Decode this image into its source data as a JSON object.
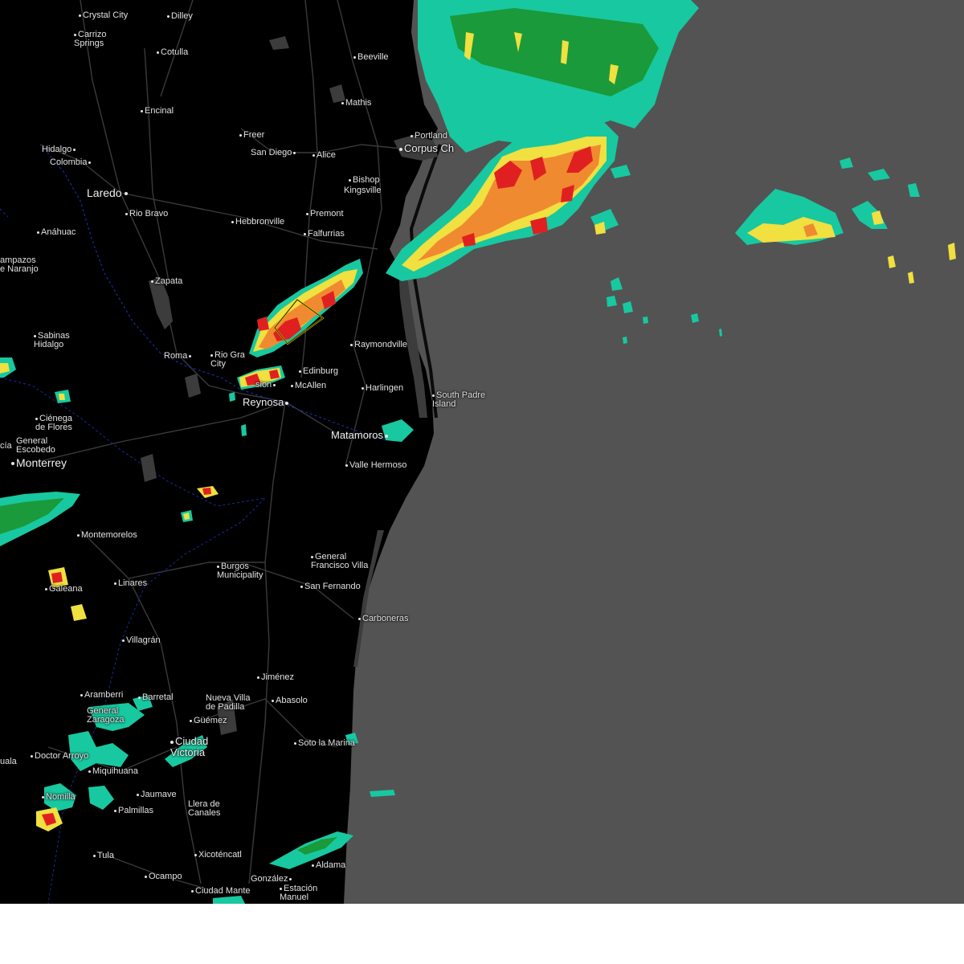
{
  "map": {
    "cities": [
      {
        "id": "crystal-city",
        "name": "Crystal City",
        "major": false
      },
      {
        "id": "dilley",
        "name": "Dilley",
        "major": false
      },
      {
        "id": "carrizo-springs",
        "name": "Carrizo\nSprings",
        "major": false
      },
      {
        "id": "cotulla",
        "name": "Cotulla",
        "major": false
      },
      {
        "id": "beeville",
        "name": "Beeville",
        "major": false
      },
      {
        "id": "mathis",
        "name": "Mathis",
        "major": false
      },
      {
        "id": "encinal",
        "name": "Encinal",
        "major": false
      },
      {
        "id": "freer",
        "name": "Freer",
        "major": false
      },
      {
        "id": "portland",
        "name": "Portland",
        "major": false
      },
      {
        "id": "corpus-christi",
        "name": "Corpus Ch",
        "major": true
      },
      {
        "id": "hidalgo-mx",
        "name": "Hidalgo",
        "major": false
      },
      {
        "id": "san-diego",
        "name": "San Diego",
        "major": false
      },
      {
        "id": "alice",
        "name": "Alice",
        "major": false
      },
      {
        "id": "colombia",
        "name": "Colombia",
        "major": false
      },
      {
        "id": "bishop",
        "name": "Bishop",
        "major": false
      },
      {
        "id": "kingsville",
        "name": "Kingsville",
        "major": false
      },
      {
        "id": "laredo",
        "name": "Laredo",
        "major": true
      },
      {
        "id": "rio-bravo",
        "name": "Rio Bravo",
        "major": false
      },
      {
        "id": "premont",
        "name": "Premont",
        "major": false
      },
      {
        "id": "hebbronville",
        "name": "Hebbronville",
        "major": false
      },
      {
        "id": "anahuac",
        "name": "Anáhuac",
        "major": false
      },
      {
        "id": "falfurrias",
        "name": "Falfurrias",
        "major": false
      },
      {
        "id": "lampazos",
        "name": "ampazos\ne Naranjo",
        "major": false
      },
      {
        "id": "zapata",
        "name": "Zapata",
        "major": false
      },
      {
        "id": "sabinas-hidalgo",
        "name": "Sabinas\nHidalgo",
        "major": false
      },
      {
        "id": "raymondville",
        "name": "Raymondville",
        "major": false
      },
      {
        "id": "roma",
        "name": "Roma",
        "major": false
      },
      {
        "id": "rio-grande-city",
        "name": "Rio Gra\nCity",
        "major": false
      },
      {
        "id": "edinburg",
        "name": "Edinburg",
        "major": false
      },
      {
        "id": "mission",
        "name": "sion",
        "major": false
      },
      {
        "id": "mcallen",
        "name": "McAllen",
        "major": false
      },
      {
        "id": "harlingen",
        "name": "Harlingen",
        "major": false
      },
      {
        "id": "south-padre-island",
        "name": "South Padre\nIsland",
        "major": false
      },
      {
        "id": "reynosa",
        "name": "Reynosa",
        "major": true
      },
      {
        "id": "cienega-de-flores",
        "name": "Ciénega\nde Flores",
        "major": false
      },
      {
        "id": "matamoros",
        "name": "Matamoros",
        "major": true
      },
      {
        "id": "general-escobedo",
        "name": "General\nEscobedo",
        "major": false
      },
      {
        "id": "cia",
        "name": "cía",
        "major": false
      },
      {
        "id": "monterrey",
        "name": "Monterrey",
        "major": true
      },
      {
        "id": "valle-hermoso",
        "name": "Valle Hermoso",
        "major": false
      },
      {
        "id": "montemorelos",
        "name": "Montemorelos",
        "major": false
      },
      {
        "id": "general-francisco-villa",
        "name": "General\nFrancisco Villa",
        "major": false
      },
      {
        "id": "burgos",
        "name": "Burgos\nMunicipality",
        "major": false
      },
      {
        "id": "linares",
        "name": "Linares",
        "major": false
      },
      {
        "id": "san-fernando",
        "name": "San Fernando",
        "major": false
      },
      {
        "id": "galeana",
        "name": "Galeana",
        "major": false
      },
      {
        "id": "carboneras",
        "name": "Carboneras",
        "major": false
      },
      {
        "id": "villagran",
        "name": "Villagrán",
        "major": false
      },
      {
        "id": "jimenez",
        "name": "Jiménez",
        "major": false
      },
      {
        "id": "aramberri",
        "name": "Aramberri",
        "major": false
      },
      {
        "id": "barretal",
        "name": "Barretal",
        "major": false
      },
      {
        "id": "nueva-villa-de-padilla",
        "name": "Nueva Villa\nde Padilla",
        "major": false
      },
      {
        "id": "abasolo",
        "name": "Abasolo",
        "major": false
      },
      {
        "id": "general-zaragoza",
        "name": "General\nZaragoza",
        "major": false
      },
      {
        "id": "guemez",
        "name": "Güémez",
        "major": false
      },
      {
        "id": "ciudad-victoria",
        "name": "Ciudad\nVictoria",
        "major": true
      },
      {
        "id": "soto-la-marina",
        "name": "Soto la Marina",
        "major": false
      },
      {
        "id": "uala",
        "name": "uala",
        "major": false
      },
      {
        "id": "doctor-arroyo",
        "name": "Doctor Arroyo",
        "major": false
      },
      {
        "id": "miquihuana",
        "name": "Miquihuana",
        "major": false
      },
      {
        "id": "jaumave",
        "name": "Jaumave",
        "major": false
      },
      {
        "id": "matehuala",
        "name": "Nomilla",
        "major": false
      },
      {
        "id": "llera",
        "name": "Llera de\nCanales",
        "major": false
      },
      {
        "id": "palmillas",
        "name": "Palmillas",
        "major": false
      },
      {
        "id": "tula",
        "name": "Tula",
        "major": false
      },
      {
        "id": "xicotencatl",
        "name": "Xicoténcatl",
        "major": false
      },
      {
        "id": "aldama",
        "name": "Aldama",
        "major": false
      },
      {
        "id": "ocampo",
        "name": "Ocampo",
        "major": false
      },
      {
        "id": "gonzalez",
        "name": "González",
        "major": false
      },
      {
        "id": "ciudad-mante",
        "name": "Ciudad Mante",
        "major": false
      },
      {
        "id": "estacion-manuel",
        "name": "Estación\nManuel",
        "major": false
      }
    ],
    "colors": {
      "land": "#000000",
      "water": "#535353",
      "roads": "#3a3a3a",
      "border": "#1a2aa0",
      "radar_light": "#18c8a0",
      "radar_green": "#1a9a3a",
      "radar_yellow": "#f0e040",
      "radar_orange": "#f08a30",
      "radar_red": "#e02020",
      "warning_polygon": "#e8d000"
    }
  }
}
